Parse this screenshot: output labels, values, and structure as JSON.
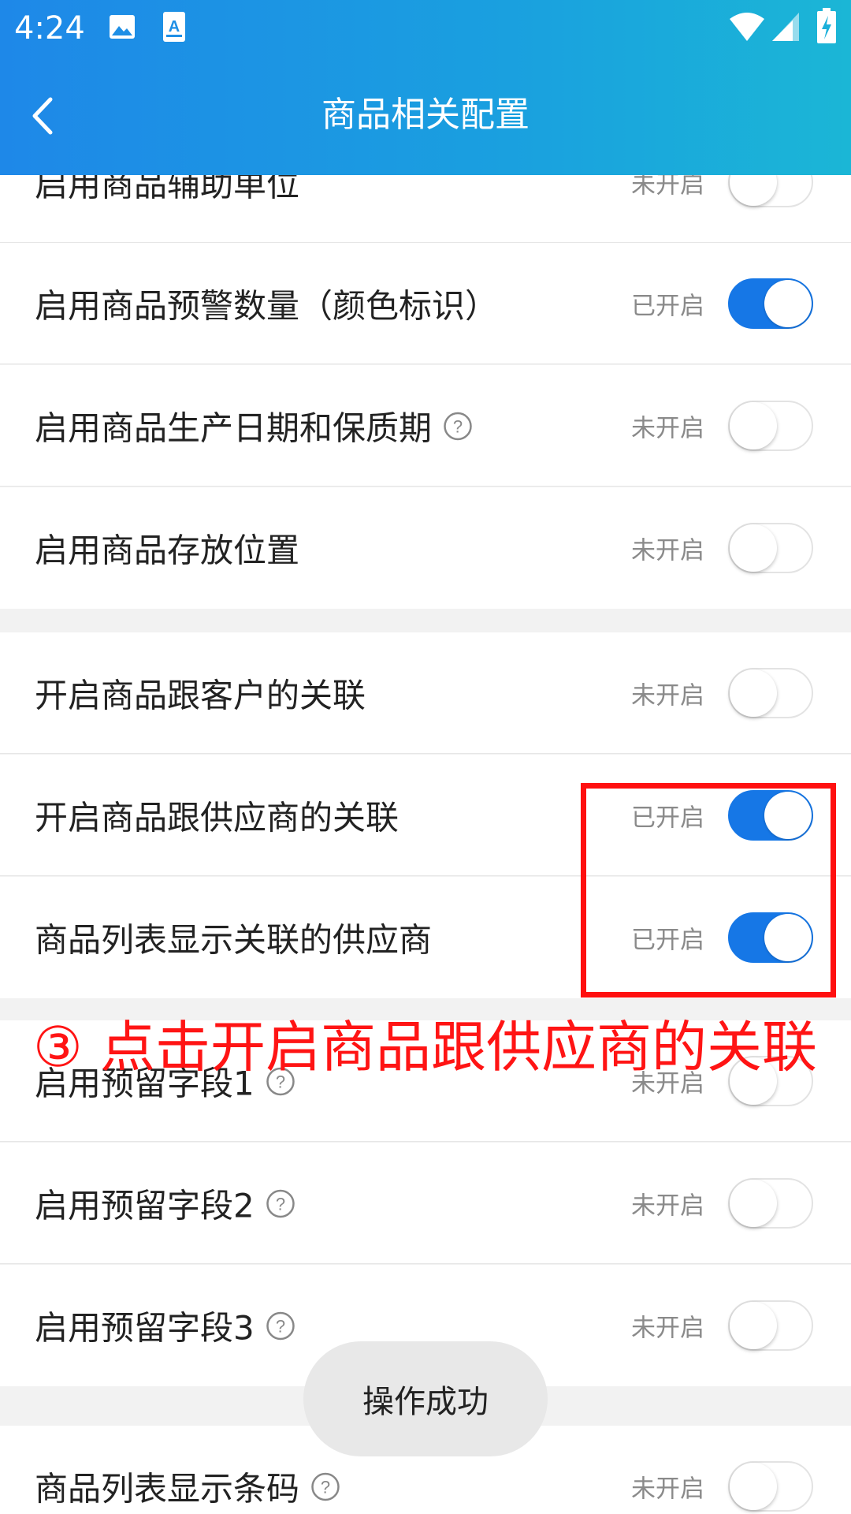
{
  "status_bar": {
    "time": "4:24",
    "icons": [
      "gallery-icon",
      "accessibility-a-icon",
      "wifi-icon",
      "cell-signal-icon",
      "battery-charging-icon"
    ]
  },
  "nav": {
    "title": "商品相关配置",
    "back_icon": "chevron-left-icon"
  },
  "settings": [
    {
      "label": "启用商品辅助单位",
      "status": "未开启",
      "enabled": false,
      "help": false
    },
    {
      "label": "启用商品预警数量（颜色标识）",
      "status": "已开启",
      "enabled": true,
      "help": false
    },
    {
      "label": "启用商品生产日期和保质期",
      "status": "未开启",
      "enabled": false,
      "help": true
    },
    {
      "label": "启用商品存放位置",
      "status": "未开启",
      "enabled": false,
      "help": false
    },
    {
      "label": "开启商品跟客户的关联",
      "status": "未开启",
      "enabled": false,
      "help": false
    },
    {
      "label": "开启商品跟供应商的关联",
      "status": "已开启",
      "enabled": true,
      "help": false
    },
    {
      "label": "商品列表显示关联的供应商",
      "status": "已开启",
      "enabled": true,
      "help": false
    },
    {
      "label": "启用预留字段1",
      "status": "未开启",
      "enabled": false,
      "help": true
    },
    {
      "label": "启用预留字段2",
      "status": "未开启",
      "enabled": false,
      "help": true
    },
    {
      "label": "启用预留字段3",
      "status": "未开启",
      "enabled": false,
      "help": true
    },
    {
      "label": "商品列表显示条码",
      "status": "未开启",
      "enabled": false,
      "help": true
    }
  ],
  "annotation": {
    "text": "③ 点击开启商品跟供应商的关联",
    "color": "#ff1414"
  },
  "toast": {
    "text": "操作成功"
  },
  "colors": {
    "header_start": "#1e88e8",
    "header_end": "#1bb6d6",
    "toggle_on": "#1677e6"
  }
}
